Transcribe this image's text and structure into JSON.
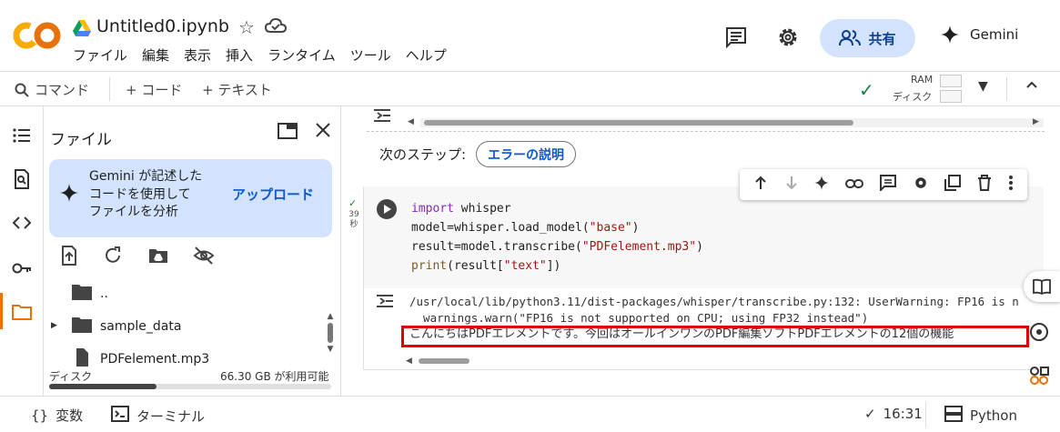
{
  "header": {
    "title": "Untitled0.ipynb",
    "share_label": "共有",
    "gemini_label": "Gemini",
    "menu": [
      "ファイル",
      "編集",
      "表示",
      "挿入",
      "ランタイム",
      "ツール",
      "ヘルプ"
    ]
  },
  "toolbar": {
    "command_label": "コマンド",
    "code_label": "+ コード",
    "text_label": "+ テキスト",
    "ram_label": "RAM",
    "disk_label": "ディスク"
  },
  "panel": {
    "title": "ファイル",
    "gemini_card_text": "Gemini が記述した\nコードを使用して\nファイルを分析",
    "gemini_card_link": "アップロード",
    "files": [
      {
        "name": ".."
      },
      {
        "name": "sample_data"
      },
      {
        "name": "PDFelement.mp3"
      }
    ],
    "disk_label": "ディスク",
    "disk_value": "66.30 GB が利用可能",
    "disk_used_fraction": 0.38
  },
  "notebook": {
    "next_steps_label": "次のステップ:",
    "explain_error_label": "エラーの説明",
    "exec_time": "39\n秒",
    "output_line1": "/usr/local/lib/python3.11/dist-packages/whisper/transcribe.py:132: UserWarning: FP16 is n",
    "output_line2": "  warnings.warn(\"FP16 is not supported on CPU; using FP32 instead\")",
    "output_line3": "こんにちはPDFエレメントです。今回はオールインワンのPDF編集ソフトPDFエレメントの12個の機能"
  },
  "status": {
    "variables_label": "変数",
    "terminal_label": "ターミナル",
    "time": "16:31",
    "runtime_label": "Python"
  }
}
